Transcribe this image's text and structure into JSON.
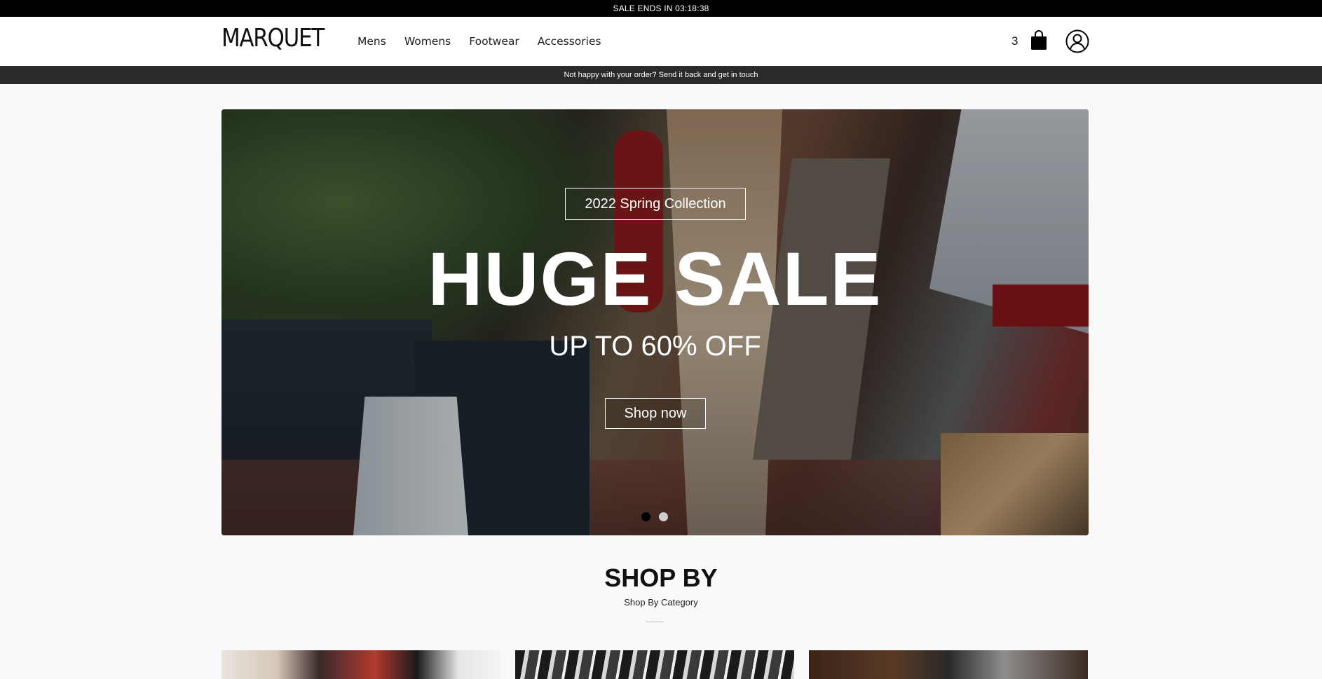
{
  "announcement": "SALE ENDS IN 03:18:38",
  "header": {
    "logo": "MARQUET",
    "nav": [
      "Mens",
      "Womens",
      "Footwear",
      "Accessories"
    ],
    "cart_count": "3"
  },
  "info_bar": "Not happy with your order? Send it back and get in touch",
  "hero": {
    "tag": "2022 Spring Collection",
    "headline": "HUGE SALE",
    "subheadline": "UP TO 60% OFF",
    "cta": "Shop now",
    "slides": 2,
    "active_slide": 1
  },
  "shop_by": {
    "title": "SHOP BY",
    "subtitle": "Shop By Category"
  },
  "icons": {
    "cart": "shopping-bag-icon",
    "account": "user-circle-icon"
  },
  "colors": {
    "topbar": "#000000",
    "infobar": "#2a2a2a",
    "background": "#f9f9f9"
  }
}
